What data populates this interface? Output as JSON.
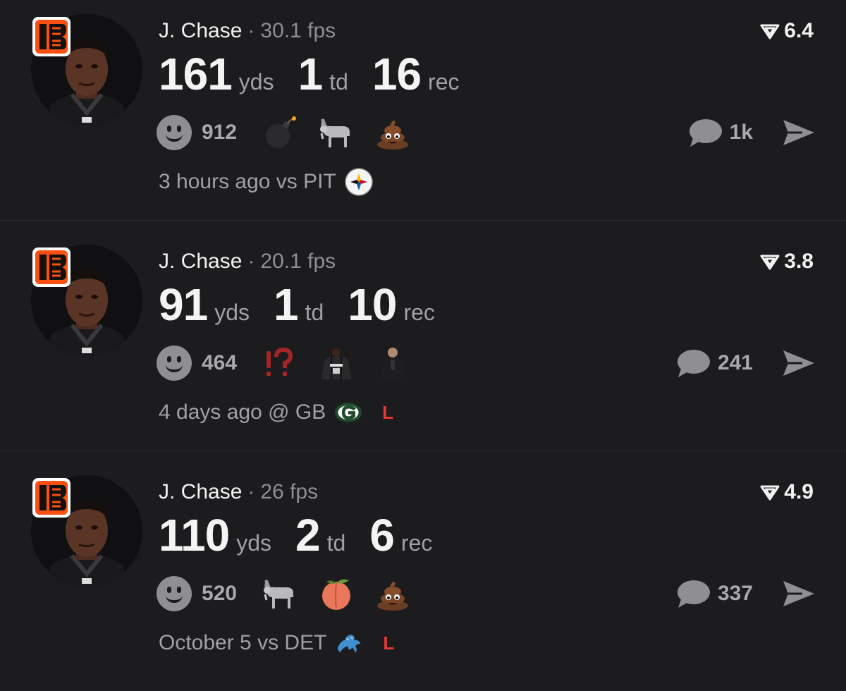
{
  "colors": {
    "background": "#1c1c1e",
    "primary_text": "#f4f4f4",
    "secondary_text": "#a0a0a5",
    "loss": "#e53935",
    "bengals_orange": "#fb4f14"
  },
  "posts": [
    {
      "player": "J. Chase",
      "separator": "·",
      "fps": "30.1 fps",
      "score": "6.4",
      "stats": [
        {
          "value": "161",
          "unit": "yds"
        },
        {
          "value": "1",
          "unit": "td"
        },
        {
          "value": "16",
          "unit": "rec"
        }
      ],
      "reaction_count": "912",
      "emojis": [
        "bomb-icon",
        "goat-icon",
        "poop-icon"
      ],
      "comment_count": "1k",
      "time": "3 hours ago",
      "matchup": "vs PIT",
      "opponent_logo": "steelers-logo",
      "result": ""
    },
    {
      "player": "J. Chase",
      "separator": "·",
      "fps": "20.1 fps",
      "score": "3.8",
      "stats": [
        {
          "value": "91",
          "unit": "yds"
        },
        {
          "value": "1",
          "unit": "td"
        },
        {
          "value": "10",
          "unit": "rec"
        }
      ],
      "reaction_count": "464",
      "emoji_text": "⁉",
      "emojis": [
        "interrobang-icon",
        "jersey-player-icon",
        "coach-icon"
      ],
      "comment_count": "241",
      "time": "4 days ago",
      "matchup": "@ GB",
      "opponent_logo": "packers-logo",
      "result": "L"
    },
    {
      "player": "J. Chase",
      "separator": "·",
      "fps": "26 fps",
      "score": "4.9",
      "stats": [
        {
          "value": "110",
          "unit": "yds"
        },
        {
          "value": "2",
          "unit": "td"
        },
        {
          "value": "6",
          "unit": "rec"
        }
      ],
      "reaction_count": "520",
      "emojis": [
        "goat-icon",
        "peach-icon",
        "poop-icon"
      ],
      "comment_count": "337",
      "time": "October 5",
      "matchup": "vs DET",
      "opponent_logo": "lions-logo",
      "result": "L"
    }
  ]
}
